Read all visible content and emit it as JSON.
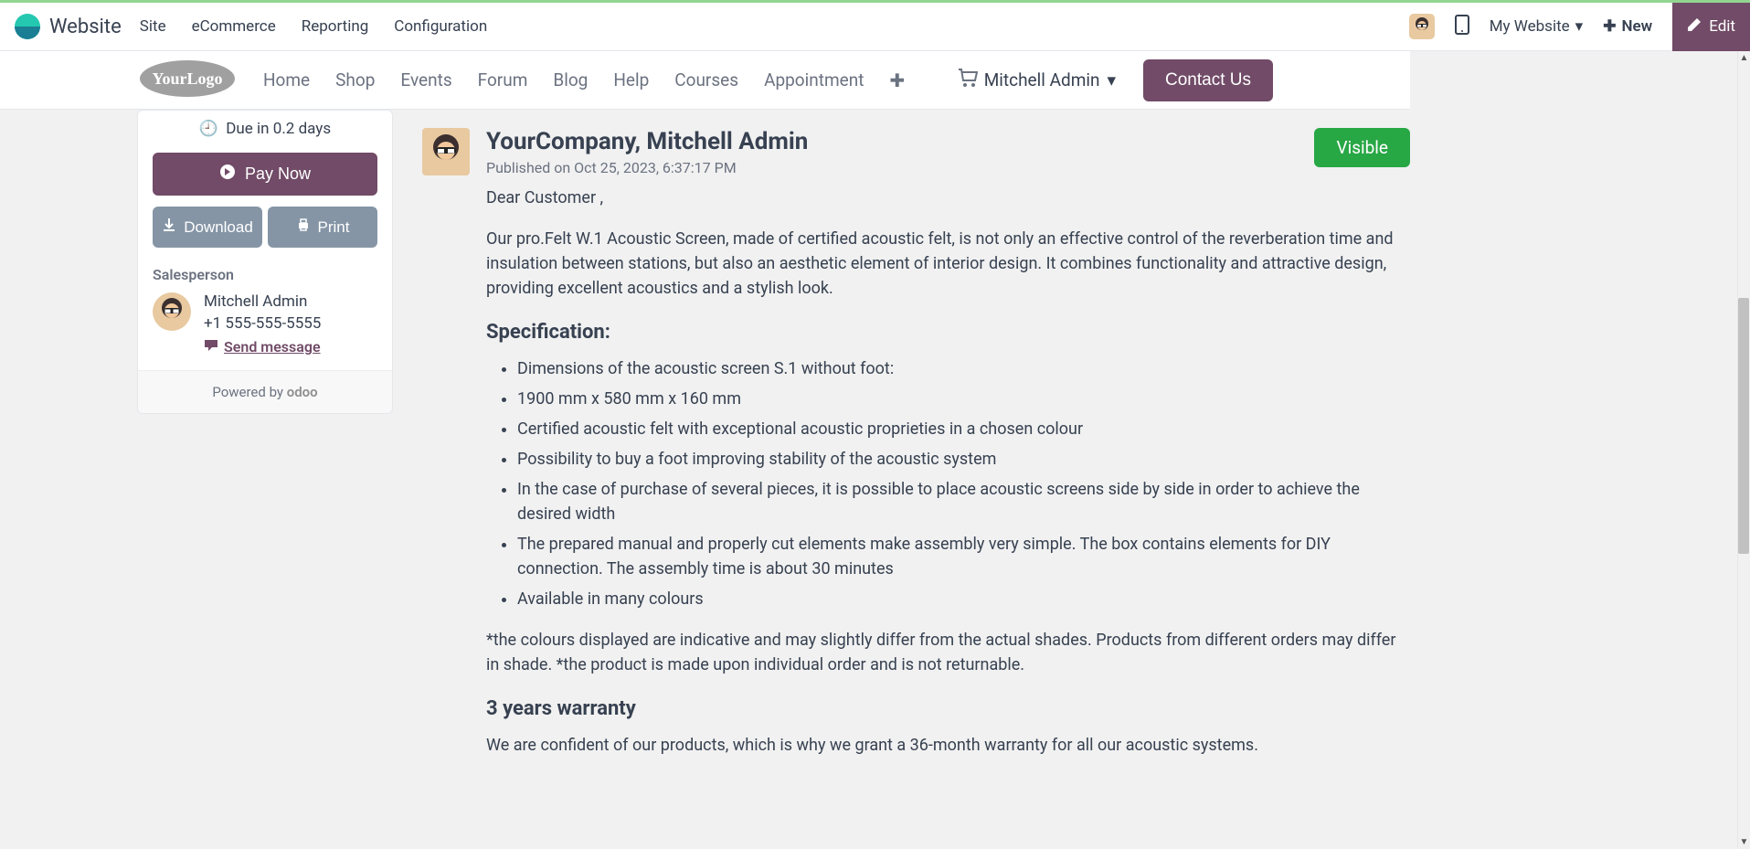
{
  "admin": {
    "brand": "Website",
    "menu": [
      "Site",
      "eCommerce",
      "Reporting",
      "Configuration"
    ],
    "my_website": "My Website",
    "new": "New",
    "edit": "Edit"
  },
  "site_nav": {
    "items": [
      "Home",
      "Shop",
      "Events",
      "Forum",
      "Blog",
      "Help",
      "Courses",
      "Appointment"
    ],
    "user": "Mitchell Admin",
    "contact": "Contact Us"
  },
  "sidebar": {
    "due": "Due in 0.2 days",
    "pay": "Pay Now",
    "download": "Download",
    "print": "Print",
    "sp_label": "Salesperson",
    "sp_name": "Mitchell Admin",
    "sp_phone": "+1 555-555-5555",
    "sp_msg": "Send message",
    "powered": "Powered by ",
    "powered_brand": "odoo"
  },
  "message": {
    "author": "YourCompany, Mitchell Admin",
    "published": "Published on Oct 25, 2023, 6:37:17 PM",
    "visible": "Visible",
    "greeting": "Dear Customer ,",
    "intro": "Our pro.Felt W.1 Acoustic Screen, made of certified acoustic felt, is not only an effective control of the reverberation time and insulation between stations, but also an aesthetic element of interior design. It combines functionality and attractive design, providing excellent acoustics and a stylish look.",
    "spec_heading": "Specification:",
    "specs": [
      "Dimensions of the acoustic screen S.1 without foot:",
      "1900 mm x 580 mm x 160 mm",
      "Certified acoustic felt with exceptional acoustic proprieties in a chosen colour",
      "Possibility to buy a foot improving stability of the acoustic system",
      "In the case of purchase of several pieces, it is possible to place acoustic screens side by side in order to achieve the desired width",
      "The prepared manual and properly cut elements make assembly very simple. The box contains elements for DIY connection. The assembly time is about 30 minutes",
      "Available in many colours"
    ],
    "note": "*the colours displayed are indicative and may slightly differ from the actual shades. Products from different orders may differ in shade. *the product is made upon individual order and is not returnable.",
    "warranty_heading": "3 years warranty",
    "warranty_text": "We are confident of our products, which is why we grant a 36-month warranty for all our acoustic systems."
  }
}
